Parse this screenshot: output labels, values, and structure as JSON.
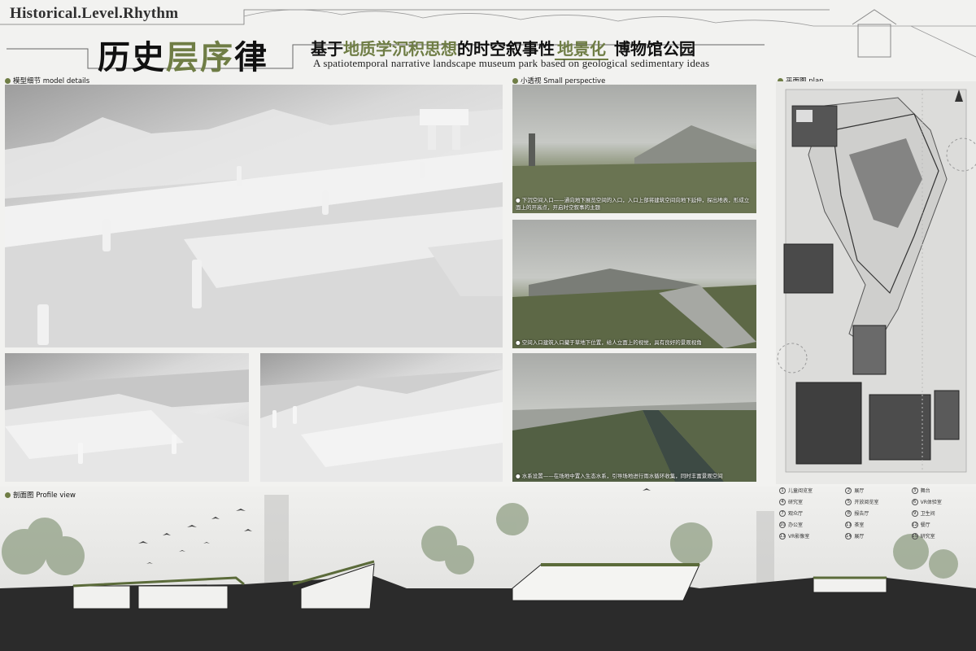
{
  "header": {
    "title_en": "Historical.Level.Rhythm",
    "title_cn_part1": "历史",
    "title_cn_accent": "层序",
    "title_cn_part2": "律",
    "subtitle_cn_part1": "基于",
    "subtitle_cn_accent1": "地质学沉积思想",
    "subtitle_cn_part2": "的时空叙事性",
    "subtitle_cn_boxed": "地景化",
    "subtitle_cn_part3": "博物馆公园",
    "subtitle_en": "A spatiotemporal narrative landscape museum park based on geological sedimentary ideas"
  },
  "sections": {
    "model": "模型细节  model details",
    "perspective": "小透视  Small perspective",
    "plan": "平面图  plan",
    "profile": "剖面图  Profile view"
  },
  "perspective_captions": [
    "● 下沉空间入口——通向地下展览空间的入口，入口上部将建筑空间向地下延伸，探出地表，形成立面上的开高点，开启时空叙事的主题",
    "● 空间入口建筑入口藏于草地下位置，给人立面上的视觉，具有良好的景观视角",
    "● 水系设置——在场地中置入生态水系，引导场地进行雨水循环收集，同时丰富景观空间"
  ],
  "legend": [
    {
      "num": "1",
      "label": "儿童阅览室"
    },
    {
      "num": "2",
      "label": "展厅"
    },
    {
      "num": "3",
      "label": "舞台"
    },
    {
      "num": "4",
      "label": "研究室"
    },
    {
      "num": "5",
      "label": "开放阅览室"
    },
    {
      "num": "6",
      "label": "VR体验室"
    },
    {
      "num": "7",
      "label": "观众厅"
    },
    {
      "num": "8",
      "label": "报告厅"
    },
    {
      "num": "9",
      "label": "卫生间"
    },
    {
      "num": "10",
      "label": "办公室"
    },
    {
      "num": "11",
      "label": "茶室"
    },
    {
      "num": "12",
      "label": "餐厅"
    },
    {
      "num": "13",
      "label": "VR影像室"
    },
    {
      "num": "14",
      "label": "展厅"
    },
    {
      "num": "15",
      "label": "研究室"
    }
  ],
  "colors": {
    "accent": "#6f7d45",
    "ground": "#2b2b2b"
  }
}
